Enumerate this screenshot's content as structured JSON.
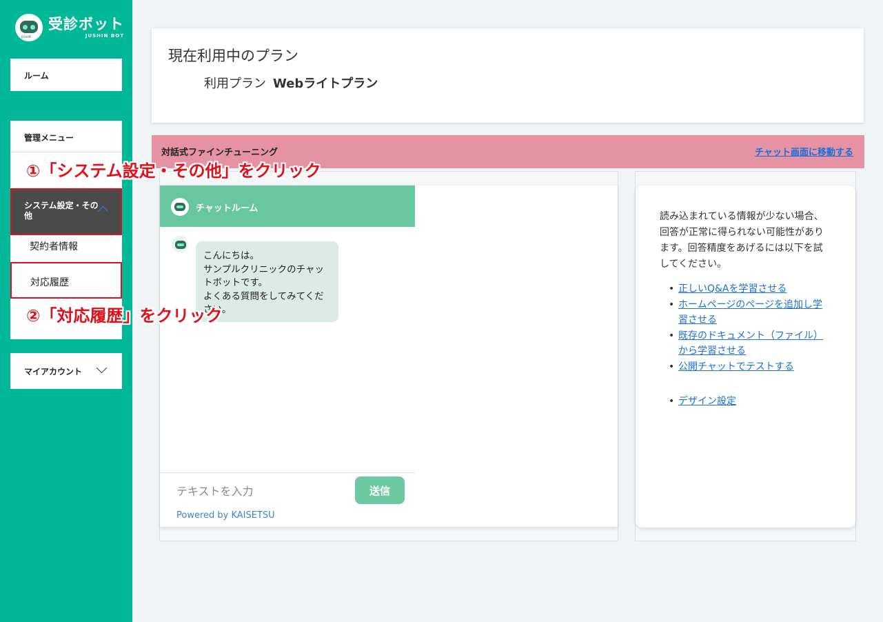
{
  "sidebar": {
    "logo_title": "受診ボット",
    "logo_sub": "JUSHIN BOT",
    "logo_tag": "JUSHIN",
    "room_label": "ルーム",
    "mgmt_menu_label": "管理メニュー",
    "system_settings_label": "システム設定・その他",
    "contract_info_label": "契約者情報",
    "history_label": "対応履歴",
    "my_account_label": "マイアカウント"
  },
  "plan": {
    "heading": "現在利用中のプラン",
    "label": "利用プラン",
    "value": "Webライトプラン"
  },
  "banner": {
    "title": "対話式ファインチューニング",
    "link": "チャット画面に移動する"
  },
  "chat": {
    "header_title": "チャットルーム",
    "message": "こんにちは。\nサンプルクリニックのチャットボットです。\nよくある質問をしてみてください。",
    "input_placeholder": "テキストを入力",
    "send_label": "送信",
    "powered_by": "Powered by KAISETSU"
  },
  "info": {
    "text": "読み込まれている情報が少ない場合、回答が正常に得られない可能性があります。回答精度をあげるには以下を試してください。",
    "links": [
      "正しいQ&Aを学習させる",
      "ホームページのページを追加し学習させる",
      "既存のドキュメント（ファイル）から学習させる",
      "公開チャットでテストする",
      "デザイン設定"
    ]
  },
  "annotations": {
    "step1": "①「システム設定・その他」をクリック",
    "step2": "②「対応履歴」をクリック"
  },
  "colors": {
    "sidebar": "#00b898",
    "chat_header": "#68c6a0",
    "banner": "#e593a4",
    "annotation": "#e0101a",
    "link": "#1a6fd6"
  },
  "icons": {
    "logo": "robot-logo-icon",
    "bot": "robot-icon",
    "expand": "chevron-up-icon",
    "collapse": "chevron-down-icon"
  }
}
